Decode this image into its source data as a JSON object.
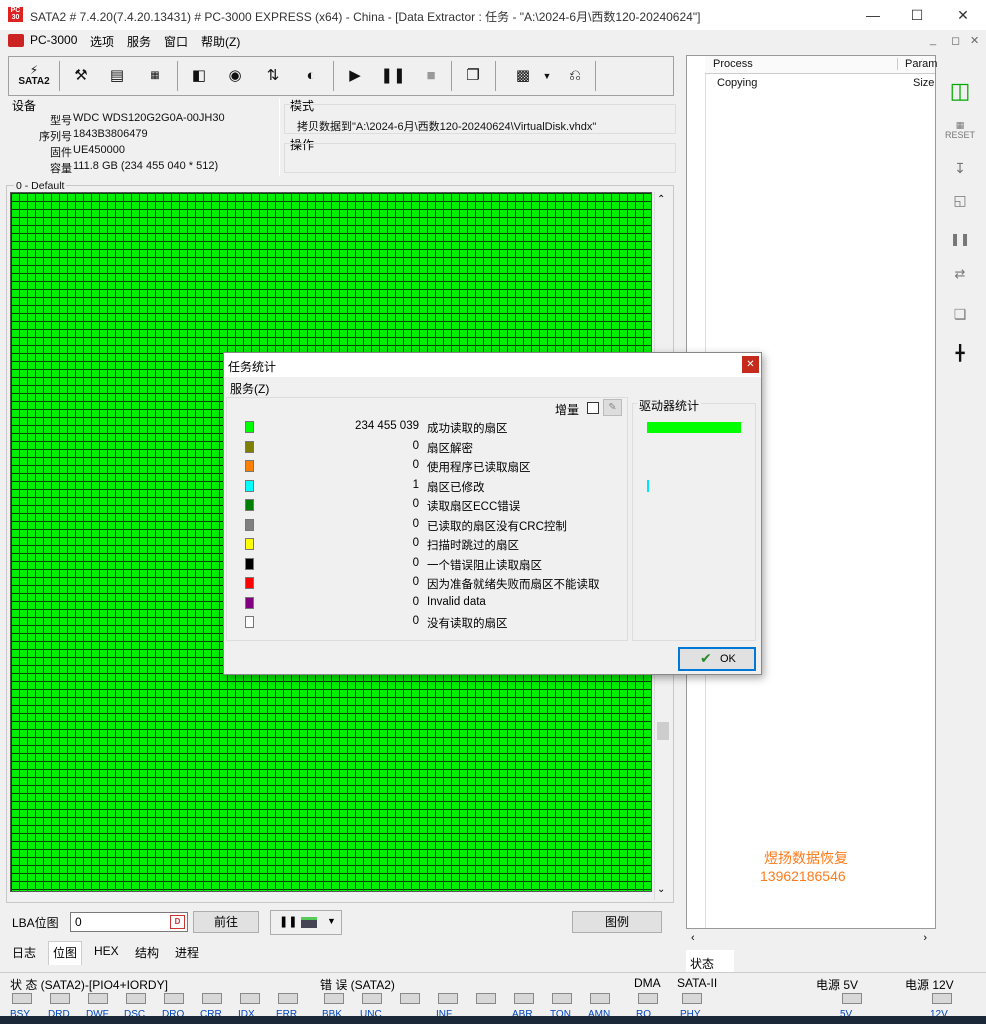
{
  "window": {
    "title": "SATA2 # 7.4.20(7.4.20.13431) # PC-3000 EXPRESS (x64) - China - [Data Extractor : 任务 - \"A:\\2024-6月\\西数120-20240624\"]"
  },
  "menu": {
    "app": "PC-3000",
    "items": [
      "选项",
      "服务",
      "窗口",
      "帮助(Z)"
    ]
  },
  "toolbar": {
    "sata_label": "SATA2"
  },
  "device": {
    "group_label": "设备",
    "rows": [
      {
        "label": "型号",
        "value": "WDC WDS120G2G0A-00JH30"
      },
      {
        "label": "序列号",
        "value": "1843B3806479"
      },
      {
        "label": "固件",
        "value": "UE450000"
      },
      {
        "label": "容量",
        "value": "111.8 GB (234 455 040 * 512)"
      }
    ]
  },
  "mode": {
    "group_label": "模式",
    "text": "拷贝数据到\"A:\\2024-6月\\西数120-20240624\\VirtualDisk.vhdx\""
  },
  "operation": {
    "group_label": "操作"
  },
  "map": {
    "group_label": "0 - Default"
  },
  "process_panel": {
    "headers": [
      "Process",
      "Param"
    ],
    "row": [
      "Copying",
      "Size"
    ]
  },
  "status_tab": "状态",
  "lba": {
    "label": "LBA位图",
    "value": "0",
    "goto_button": "前往",
    "legend_button": "图例"
  },
  "tabs": [
    "日志",
    "位图",
    "HEX",
    "结构",
    "进程"
  ],
  "dialog": {
    "title": "任务统计",
    "menu": "服务(Z)",
    "increment_label": "增量",
    "drive_stats_label": "驱动器统计",
    "ok_button": "OK",
    "legend": [
      {
        "color": "#00ff00",
        "count": "234 455 039",
        "label": "成功读取的扇区"
      },
      {
        "color": "#808000",
        "count": "0",
        "label": "扇区解密"
      },
      {
        "color": "#ff8000",
        "count": "0",
        "label": "使用程序已读取扇区"
      },
      {
        "color": "#00ffff",
        "count": "1",
        "label": "扇区已修改"
      },
      {
        "color": "#008000",
        "count": "0",
        "label": "读取扇区ECC错误"
      },
      {
        "color": "#808080",
        "count": "0",
        "label": "已读取的扇区没有CRC控制"
      },
      {
        "color": "#ffff00",
        "count": "0",
        "label": "扫描时跳过的扇区"
      },
      {
        "color": "#000000",
        "count": "0",
        "label": "一个错误阻止读取扇区"
      },
      {
        "color": "#ff0000",
        "count": "0",
        "label": "因为准备就绪失败而扇区不能读取"
      },
      {
        "color": "#800080",
        "count": "0",
        "label": "Invalid data"
      },
      {
        "color": "#ffffff",
        "count": "0",
        "label": "没有读取的扇区"
      }
    ]
  },
  "watermark": {
    "line1": "煜扬数据恢复",
    "line2": "13962186546"
  },
  "statusbar": {
    "status_label": "状 态 (SATA2)-[PIO4+IORDY]",
    "error_label": "错 误 (SATA2)",
    "dma_label": "DMA",
    "sata_label": "SATA-II",
    "power5_label": "电源 5V",
    "power12_label": "电源 12V",
    "status_leds": [
      "BSY",
      "DRD",
      "DWF",
      "DSC",
      "DRQ",
      "CRR",
      "IDX",
      "ERR"
    ],
    "error_leds": [
      "BBK",
      "UNC",
      "",
      "INF",
      "",
      "ABR",
      "TON",
      "AMN"
    ],
    "dma_leds": [
      "RQ"
    ],
    "sata_leds": [
      "PHY"
    ],
    "power5_leds": [
      "5V"
    ],
    "power12_leds": [
      "12V"
    ]
  },
  "colors": {
    "map_green": "#00ee00",
    "grid_line": "#004400",
    "accent": "#0078d7",
    "watermark": "#ff7a1a"
  }
}
